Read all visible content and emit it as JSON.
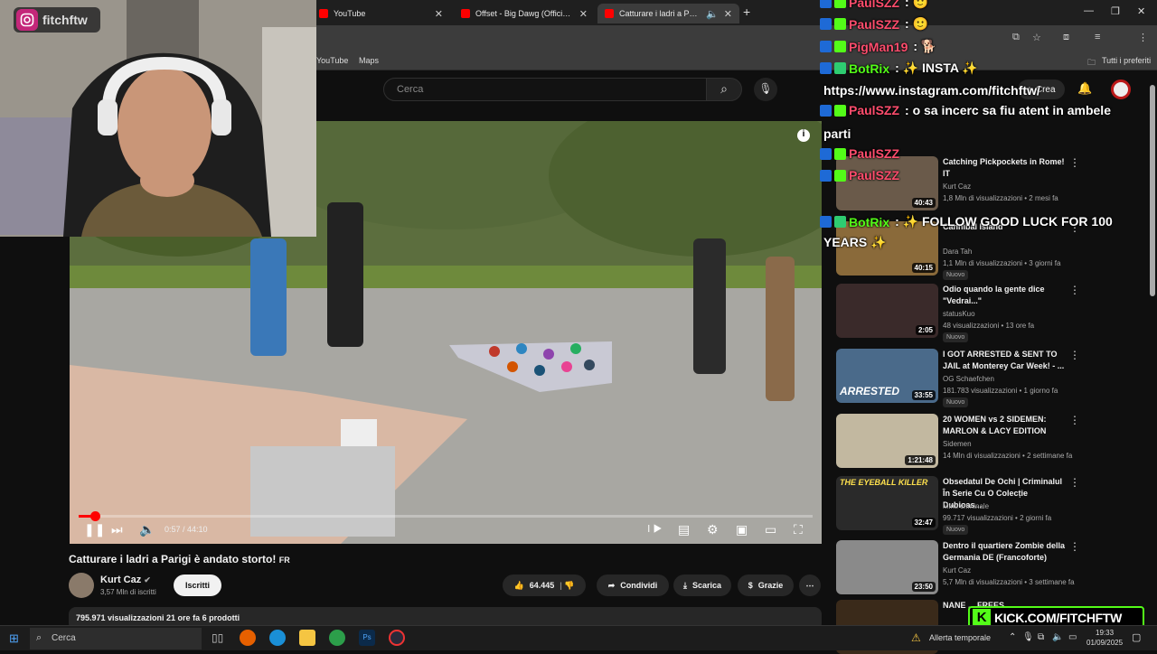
{
  "browser": {
    "tabs": [
      {
        "label": "YouTube"
      },
      {
        "label": "Offset - Big Dawg (Official Audio)"
      },
      {
        "label": "Catturare i ladri a Parigi è andato storto"
      }
    ],
    "bookmarks": [
      "YouTube",
      "Maps"
    ],
    "bookmarks_folder": "Tutti i preferiti"
  },
  "youtube": {
    "search_placeholder": "Cerca",
    "create_label": "Crea",
    "player": {
      "progress_fraction": 0.022,
      "time_current": "0:57",
      "time_total": "44:10",
      "time_display": "0:57 / 44:10"
    },
    "video_title": "Catturare i ladri a Parigi è andato storto!",
    "title_suffix": "FR",
    "channel": {
      "name": "Kurt Caz",
      "subscribers": "3,57 Mln di iscritti",
      "subscribe_label": "Iscritti"
    },
    "actions": {
      "likes": "64.445",
      "share": "Condividi",
      "download": "Scarica",
      "thanks": "Grazie"
    },
    "description_summary": "795.971 visualizzazioni  21 ore fa  6 prodotti",
    "recommendations": [
      {
        "title": "Catching Pickpockets in Rome! IT",
        "channel": "Kurt Caz",
        "meta": "1,8 Mln di visualizzazioni • 2 mesi fa",
        "duration": "40:43",
        "badge": ""
      },
      {
        "title": "Cannibal Island",
        "channel": "Dara Tah",
        "meta": "1,1 Mln di visualizzazioni • 3 giorni fa",
        "duration": "40:15",
        "badge": "Nuovo"
      },
      {
        "title": "Odio quando la gente dice \"Vedrai...\"",
        "channel": "statusKuo",
        "meta": "48 visualizzazioni • 13 ore fa",
        "duration": "2:05",
        "badge": "Nuovo"
      },
      {
        "title": "I GOT ARRESTED & SENT TO JAIL at Monterey Car Week! - ...",
        "channel": "OG Schaefchen",
        "meta": "181.783 visualizzazioni • 1 giorno fa",
        "duration": "33:55",
        "badge": "Nuovo",
        "thumb_text": "ARRESTED"
      },
      {
        "title": "20 WOMEN vs 2 SIDEMEN: MARLON & LACY EDITION",
        "channel": "Sidemen",
        "meta": "14 Mln di visualizzazioni • 2 settimane fa",
        "duration": "1:21:48",
        "badge": ""
      },
      {
        "title": "Obsedatul De Ochi | Criminalul În Serie Cu O Colecție Dubioas...",
        "channel": "Minti criminale",
        "meta": "99.717 visualizzazioni • 2 giorni fa",
        "duration": "32:47",
        "badge": "Nuovo",
        "thumb_text": "THE EYEBALL KILLER"
      },
      {
        "title": "Dentro il quartiere Zombie della Germania DE (Francoforte)",
        "channel": "Kurt Caz",
        "meta": "5,7 Mln di visualizzazioni • 3 settimane fa",
        "duration": "23:50",
        "badge": ""
      },
      {
        "title": "NANE ... FREES...",
        "channel": "",
        "meta": "",
        "duration": "",
        "badge": ""
      }
    ]
  },
  "stream_overlay": {
    "instagram_handle": "fitchftw",
    "chat": [
      {
        "user": "PaulSZZ",
        "text": ": 🙂",
        "color": "#ff4d6d"
      },
      {
        "user": "PaulSZZ",
        "text": ": 🙂",
        "color": "#ff4d6d"
      },
      {
        "user": "PigMan19",
        "text": ": 🐕",
        "color": "#ff4d6d"
      },
      {
        "user": "BotRix",
        "text": ": ✨ INSTA ✨",
        "color": "#53fc18"
      },
      {
        "user": "",
        "text": "https://www.instagram.com/fitchftw/",
        "color": "#ffffff"
      },
      {
        "user": "PaulSZZ",
        "text": ": o sa incerc sa fiu atent in ambele",
        "color": "#ff4d6d"
      },
      {
        "user": "",
        "text": "parti",
        "color": "#ffffff"
      },
      {
        "user": "PaulSZZ",
        "text": "",
        "color": "#ff4d6d"
      },
      {
        "user": "PaulSZZ",
        "text": "",
        "color": "#ff4d6d"
      },
      {
        "user": "BotRix",
        "text": ": ✨ FOLLOW GOOD LUCK FOR 100",
        "color": "#53fc18"
      },
      {
        "user": "",
        "text": "YEARS ✨",
        "color": "#ffffff"
      }
    ],
    "kick_url": "KICK.COM/FITCHFTW"
  },
  "taskbar": {
    "search_placeholder": "Cerca",
    "weather": "Allerta temporale",
    "time": "19:33",
    "date": "01/09/2025"
  }
}
